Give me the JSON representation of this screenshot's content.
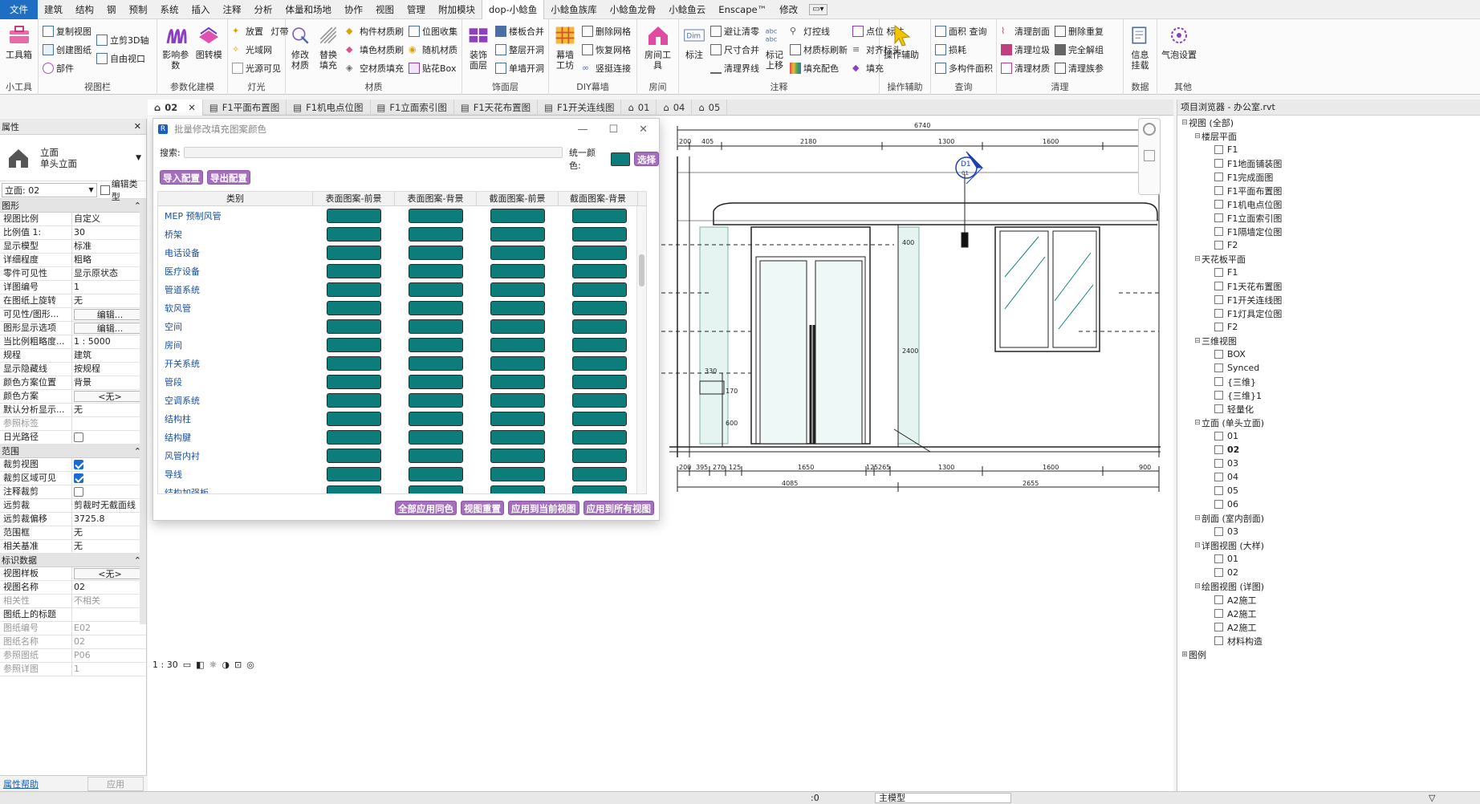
{
  "ribbon_tabs": [
    "文件",
    "建筑",
    "结构",
    "钢",
    "预制",
    "系统",
    "插入",
    "注释",
    "分析",
    "体量和场地",
    "协作",
    "视图",
    "管理",
    "附加模块",
    "dop-小鲶鱼",
    "小鲶鱼族库",
    "小鲶鱼龙骨",
    "小鲶鱼云",
    "Enscape™",
    "修改"
  ],
  "ribbon_groups": {
    "g1": {
      "label": "小工具",
      "big": "工具箱"
    },
    "g2": {
      "label": "视图栏",
      "items": [
        "复制视图",
        "创建图纸",
        "部件",
        "立剪3D轴",
        "自由视口"
      ]
    },
    "g3": {
      "label": "参数化建模",
      "big1": "影响参数",
      "big2": "图转模"
    },
    "g4": {
      "label": "灯光",
      "items": [
        "放置",
        "灯带",
        "光域网",
        "光源可见"
      ]
    },
    "g5": {
      "label": "材质",
      "big1": "修改材质",
      "big2": "替换填充",
      "items": [
        "构件材质刷",
        "填色材质刷",
        "空材质填充",
        "位图收集",
        "随机材质",
        "贴花Box"
      ]
    },
    "g6": {
      "label": "饰面层",
      "big": "装饰面层",
      "items": [
        "楼板合并",
        "整层开洞",
        "单墙开洞"
      ]
    },
    "g7": {
      "label": "DIY幕墙",
      "big": "幕墙工坊",
      "items": [
        "删除网格",
        "恢复网格",
        "竖挺连接"
      ]
    },
    "g8": {
      "label": "房间",
      "big": "房间工具"
    },
    "g9": {
      "label": "注释",
      "big1": "标注",
      "big2": "标记上移",
      "items": [
        "避让清零",
        "尺寸合并",
        "清理界线",
        "灯控线",
        "材质标刷新",
        "填充配色",
        "点位 标注",
        "对齐标头",
        "填充"
      ]
    },
    "g10": {
      "label": "操作辅助",
      "big": "操作辅助"
    },
    "g11": {
      "label": "查询",
      "items": [
        "面积 查询",
        "损耗",
        "多构件面积"
      ]
    },
    "g12": {
      "label": "清理",
      "items": [
        "清理剖面",
        "清理垃圾",
        "清理材质",
        "删除重复",
        "完全解组",
        "清理族参"
      ]
    },
    "g13": {
      "label": "数据",
      "big": "信息挂载"
    },
    "g14": {
      "label": "其他",
      "big": "气泡设置"
    }
  },
  "properties": {
    "title": "属性",
    "type_name": "立面",
    "type_sub": "单头立面",
    "view_selector": "立面: 02",
    "edit_type": "编辑类型",
    "sections": [
      {
        "name": "图形",
        "rows": [
          {
            "k": "视图比例",
            "v": "自定义"
          },
          {
            "k": "比例值 1:",
            "v": "30"
          },
          {
            "k": "显示模型",
            "v": "标准"
          },
          {
            "k": "详细程度",
            "v": "粗略"
          },
          {
            "k": "零件可见性",
            "v": "显示原状态"
          },
          {
            "k": "详图编号",
            "v": "1"
          },
          {
            "k": "在图纸上旋转",
            "v": "无"
          },
          {
            "k": "可见性/图形...",
            "v": "编辑...",
            "btn": true
          },
          {
            "k": "图形显示选项",
            "v": "编辑...",
            "btn": true
          },
          {
            "k": "当比例粗略度...",
            "v": "1 : 5000"
          },
          {
            "k": "规程",
            "v": "建筑"
          },
          {
            "k": "显示隐藏线",
            "v": "按规程"
          },
          {
            "k": "颜色方案位置",
            "v": "背景"
          },
          {
            "k": "颜色方案",
            "v": "<无>",
            "btn": true
          },
          {
            "k": "默认分析显示...",
            "v": "无"
          },
          {
            "k": "参照标签",
            "v": "",
            "dim": true
          },
          {
            "k": "日光路径",
            "v": "",
            "cb": "off"
          }
        ]
      },
      {
        "name": "范围",
        "rows": [
          {
            "k": "裁剪视图",
            "v": "",
            "cb": "on"
          },
          {
            "k": "裁剪区域可见",
            "v": "",
            "cb": "on"
          },
          {
            "k": "注释裁剪",
            "v": "",
            "cb": "off"
          },
          {
            "k": "远剪裁",
            "v": "剪裁时无截面线"
          },
          {
            "k": "远剪裁偏移",
            "v": "3725.8"
          },
          {
            "k": "范围框",
            "v": "无"
          },
          {
            "k": "相关基准",
            "v": "无"
          }
        ]
      },
      {
        "name": "标识数据",
        "rows": [
          {
            "k": "视图样板",
            "v": "<无>",
            "btn": true
          },
          {
            "k": "视图名称",
            "v": "02"
          },
          {
            "k": "相关性",
            "v": "不相关",
            "dim": true
          },
          {
            "k": "图纸上的标题",
            "v": ""
          },
          {
            "k": "图纸编号",
            "v": "E02",
            "dim": true
          },
          {
            "k": "图纸名称",
            "v": "02",
            "dim": true
          },
          {
            "k": "参照图纸",
            "v": "P06",
            "dim": true
          },
          {
            "k": "参照详图",
            "v": "1",
            "dim": true
          }
        ]
      }
    ],
    "help_link": "属性帮助",
    "apply": "应用"
  },
  "view_tabs": [
    {
      "label": "02",
      "active": true
    },
    {
      "label": "F1平面布置图"
    },
    {
      "label": "F1机电点位图"
    },
    {
      "label": "F1立面索引图"
    },
    {
      "label": "F1天花布置图"
    },
    {
      "label": "F1开关连线图"
    },
    {
      "label": "01"
    },
    {
      "label": "04"
    },
    {
      "label": "05"
    }
  ],
  "dialog": {
    "title": "批量修改填充图案颜色",
    "search_label": "搜索:",
    "unify_label": "统一颜色:",
    "select_btn": "选择",
    "import_btn": "导入配置",
    "export_btn": "导出配置",
    "headers": [
      "类别",
      "表面图案-前景",
      "表面图案-背景",
      "截面图案-前景",
      "截面图案-背景"
    ],
    "rows": [
      "MEP 预制风管",
      "桥架",
      "电话设备",
      "医疗设备",
      "管道系统",
      "软风管",
      "空间",
      "房间",
      "开关系统",
      "管段",
      "空调系统",
      "结构柱",
      "结构腱",
      "风管内衬",
      "导线",
      "结构加强板"
    ],
    "actions": [
      "全部应用同色",
      "视图重置",
      "应用到当前视图",
      "应用到所有视图"
    ],
    "swatch_color": "#0c7d7b",
    "accent_color": "#a66fbe"
  },
  "drawing": {
    "dims_top": [
      "6740",
      "200",
      "405",
      "2180",
      "1300",
      "1600"
    ],
    "dims_bottom": [
      "200",
      "395",
      "270",
      "125",
      "1650",
      "125",
      "265",
      "1300",
      "1600",
      "900"
    ],
    "dims_bottom2": [
      "4085",
      "2655"
    ],
    "dims_side": [
      "400",
      "2400",
      "600",
      "330",
      "170"
    ],
    "tag_top": "D1",
    "tag_bottom": "01"
  },
  "browser": {
    "title": "项目浏览器 - 办公室.rvt",
    "nodes": [
      {
        "label": "视图 (全部)",
        "lvl": 0,
        "tg": "⊟"
      },
      {
        "label": "楼层平面",
        "lvl": 1,
        "tg": "⊟"
      },
      {
        "label": "F1",
        "lvl": 2
      },
      {
        "label": "F1地面铺装图",
        "lvl": 2
      },
      {
        "label": "F1完成面图",
        "lvl": 2
      },
      {
        "label": "F1平面布置图",
        "lvl": 2
      },
      {
        "label": "F1机电点位图",
        "lvl": 2
      },
      {
        "label": "F1立面索引图",
        "lvl": 2
      },
      {
        "label": "F1隔墙定位图",
        "lvl": 2
      },
      {
        "label": "F2",
        "lvl": 2
      },
      {
        "label": "天花板平面",
        "lvl": 1,
        "tg": "⊟"
      },
      {
        "label": "F1",
        "lvl": 2
      },
      {
        "label": "F1天花布置图",
        "lvl": 2
      },
      {
        "label": "F1开关连线图",
        "lvl": 2
      },
      {
        "label": "F1灯具定位图",
        "lvl": 2
      },
      {
        "label": "F2",
        "lvl": 2
      },
      {
        "label": "三维视图",
        "lvl": 1,
        "tg": "⊟"
      },
      {
        "label": "BOX",
        "lvl": 2
      },
      {
        "label": "Synced",
        "lvl": 2
      },
      {
        "label": "{三维}",
        "lvl": 2
      },
      {
        "label": "{三维}1",
        "lvl": 2
      },
      {
        "label": "轻量化",
        "lvl": 2
      },
      {
        "label": "立面 (单头立面)",
        "lvl": 1,
        "tg": "⊟"
      },
      {
        "label": "01",
        "lvl": 2
      },
      {
        "label": "02",
        "lvl": 2,
        "sel": true
      },
      {
        "label": "03",
        "lvl": 2
      },
      {
        "label": "04",
        "lvl": 2
      },
      {
        "label": "05",
        "lvl": 2
      },
      {
        "label": "06",
        "lvl": 2
      },
      {
        "label": "剖面 (室内剖面)",
        "lvl": 1,
        "tg": "⊟"
      },
      {
        "label": "03",
        "lvl": 2
      },
      {
        "label": "详图视图 (大样)",
        "lvl": 1,
        "tg": "⊟"
      },
      {
        "label": "01",
        "lvl": 2
      },
      {
        "label": "02",
        "lvl": 2
      },
      {
        "label": "绘图视图 (详图)",
        "lvl": 1,
        "tg": "⊟"
      },
      {
        "label": "A2施工",
        "lvl": 2
      },
      {
        "label": "A2施工",
        "lvl": 2
      },
      {
        "label": "A2施工",
        "lvl": 2
      },
      {
        "label": "材料构造",
        "lvl": 2
      },
      {
        "label": "图例",
        "lvl": 0,
        "tg": "⊞"
      }
    ]
  },
  "status": {
    "scale": "1 : 30",
    "coord": ":0",
    "model": "主模型"
  }
}
